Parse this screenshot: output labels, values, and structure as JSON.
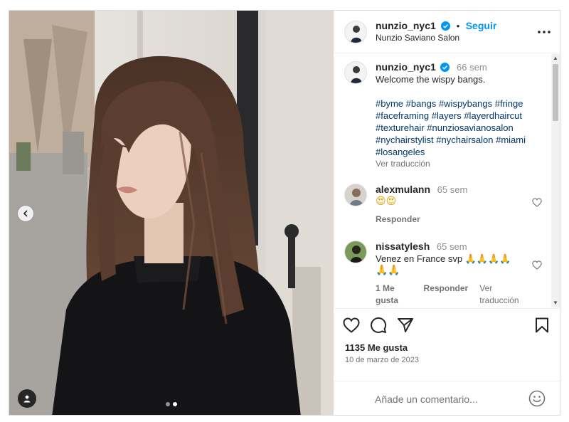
{
  "colors": {
    "accent": "#0095f6",
    "hashtag": "#00376b",
    "verified": "#0095f6"
  },
  "post": {
    "author": {
      "username": "nunzio_nyc1",
      "subtitle": "Nunzio Saviano Salon",
      "follow_label": "Seguir",
      "separator": "•"
    },
    "caption": {
      "username": "nunzio_nyc1",
      "time": "66 sem",
      "text": "Welcome the wispy bangs.",
      "hashtags": [
        [
          "#byme",
          "#bangs",
          "#wispybangs",
          "#fringe"
        ],
        [
          "#faceframing",
          "#layers",
          "#layerdhaircut"
        ],
        [
          "#texturehair",
          "#nunziosavianosalon"
        ],
        [
          "#nychairstylist",
          "#nychairsalon",
          "#miami"
        ],
        [
          "#losangeles"
        ]
      ],
      "translation_label": "Ver traducción"
    },
    "comments": [
      {
        "username": "alexmulann",
        "time": "65 sem",
        "text": "😍😍",
        "reply_label": "Responder"
      },
      {
        "username": "nissatylesh",
        "time": "65 sem",
        "text_line1": "Venez en France svp 🙏🙏🙏🙏",
        "text_line2": "🙏🙏",
        "likes_label": "1 Me gusta",
        "reply_label": "Responder",
        "translation_label": "Ver traducción"
      }
    ],
    "likes": "1135 Me gusta",
    "date": "10 de marzo de 2023",
    "add_comment_placeholder": "Añade un comentario...",
    "carousel": {
      "count": 2,
      "active_index": 1
    },
    "icons": {
      "like": "heart-icon",
      "comment": "comment-icon",
      "share": "paper-plane-icon",
      "save": "bookmark-icon",
      "more": "more-options-icon",
      "emoji": "smiley-icon",
      "prev": "chevron-left-icon",
      "tag": "user-tag-icon"
    }
  }
}
